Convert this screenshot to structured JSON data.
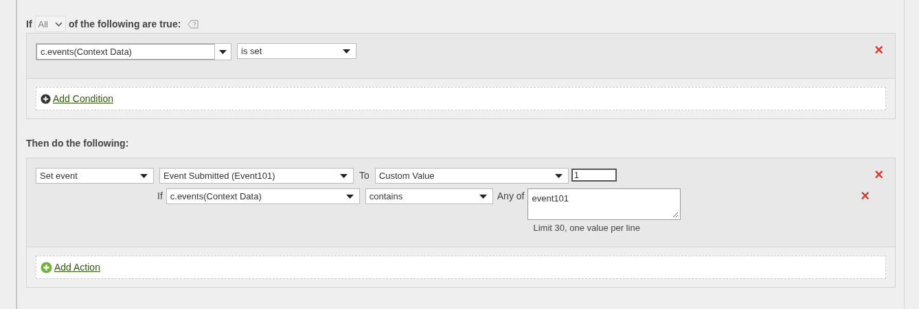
{
  "condition_header": {
    "prefix": "If",
    "quantifier": "All",
    "suffix": "of the following are true:"
  },
  "conditions": [
    {
      "field": "c.events(Context Data)",
      "operator": "is set",
      "remove": "×"
    }
  ],
  "add_condition": "Add Condition",
  "actions_header": "Then do the following:",
  "actions": [
    {
      "type": "Set event",
      "target": "Event Submitted (Event101)",
      "to_label": "To",
      "value_type": "Custom Value",
      "value": "1",
      "remove": "×",
      "sub_condition": {
        "if_label": "If",
        "field": "c.events(Context Data)",
        "operator": "contains",
        "any_of_label": "Any of",
        "values": "event101",
        "hint": "Limit 30, one value per line",
        "remove": "×"
      }
    }
  ],
  "add_action": "Add Action"
}
